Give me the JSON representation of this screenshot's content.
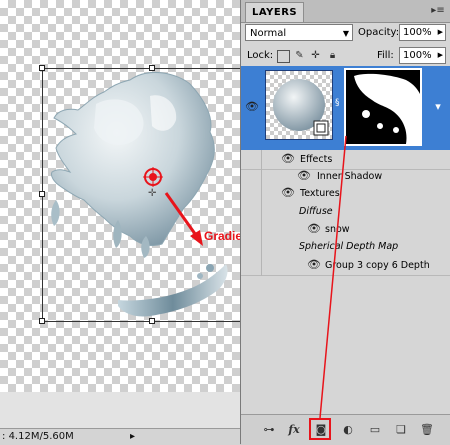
{
  "canvas": {
    "annotation": "Gradient direction"
  },
  "status_bar": {
    "doc_size": "4.12M/5.60M",
    "arrow": "▸"
  },
  "layers_panel": {
    "tab_label": "LAYERS",
    "menu_icon": "panel-menu-icon",
    "blend_mode": "Normal",
    "opacity_label": "Opacity:",
    "opacity_value": "100%",
    "lock_label": "Lock:",
    "fill_label": "Fill:",
    "fill_value": "100%",
    "layer": {
      "visible": true,
      "effects": "Effects",
      "inner_shadow": "Inner Shadow",
      "textures": "Textures",
      "diffuse": "Diffuse",
      "diffuse_item": "snow",
      "depth_map": "Spherical Depth Map",
      "depth_item": "Group 3 copy 6 Depth"
    },
    "bottom_buttons": [
      "link-icon",
      "fx-icon",
      "add-mask-icon",
      "adjustment-icon",
      "group-icon",
      "new-layer-icon",
      "trash-icon"
    ],
    "fx_label": "fx",
    "highlight_color": "#e8141b",
    "selection_color": "#3d7fd3"
  }
}
